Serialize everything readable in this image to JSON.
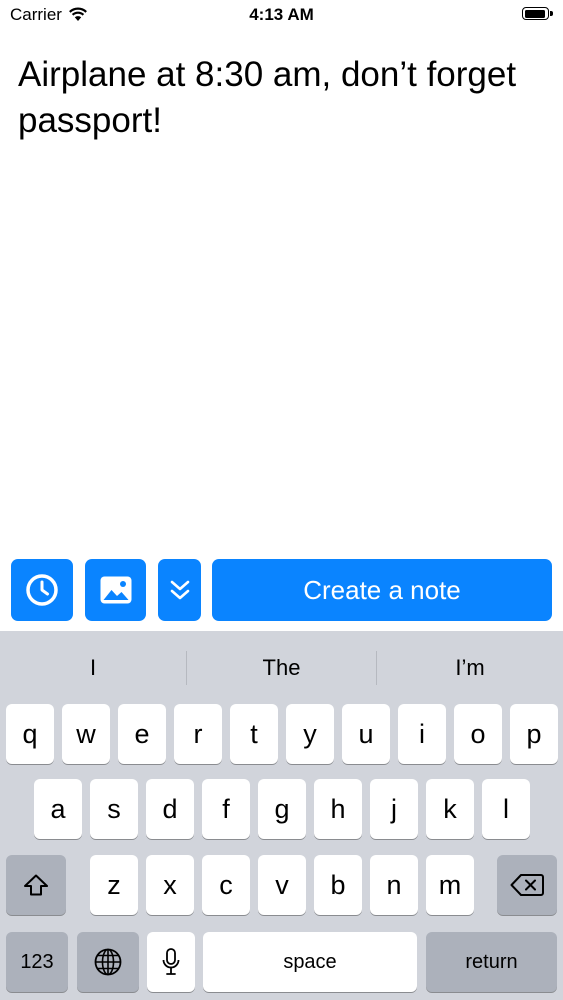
{
  "status_bar": {
    "carrier": "Carrier",
    "time": "4:13 AM",
    "icons": [
      "wifi-icon",
      "battery-icon"
    ]
  },
  "note": {
    "text": "Airplane at 8:30 am, don’t forget passport!"
  },
  "toolbar": {
    "reminder_icon": "clock-icon",
    "image_icon": "image-icon",
    "expand_icon": "double-chevron-down-icon",
    "create_label": "Create a note",
    "accent_color": "#0a84ff"
  },
  "keyboard": {
    "suggestions": [
      "I",
      "The",
      "I’m"
    ],
    "row1": [
      "q",
      "w",
      "e",
      "r",
      "t",
      "y",
      "u",
      "i",
      "o",
      "p"
    ],
    "row2": [
      "a",
      "s",
      "d",
      "f",
      "g",
      "h",
      "j",
      "k",
      "l"
    ],
    "row3": [
      "z",
      "x",
      "c",
      "v",
      "b",
      "n",
      "m"
    ],
    "shift_icon": "shift-icon",
    "delete_icon": "delete-icon",
    "numbers_label": "123",
    "globe_icon": "globe-icon",
    "mic_icon": "microphone-icon",
    "space_label": "space",
    "return_label": "return"
  }
}
